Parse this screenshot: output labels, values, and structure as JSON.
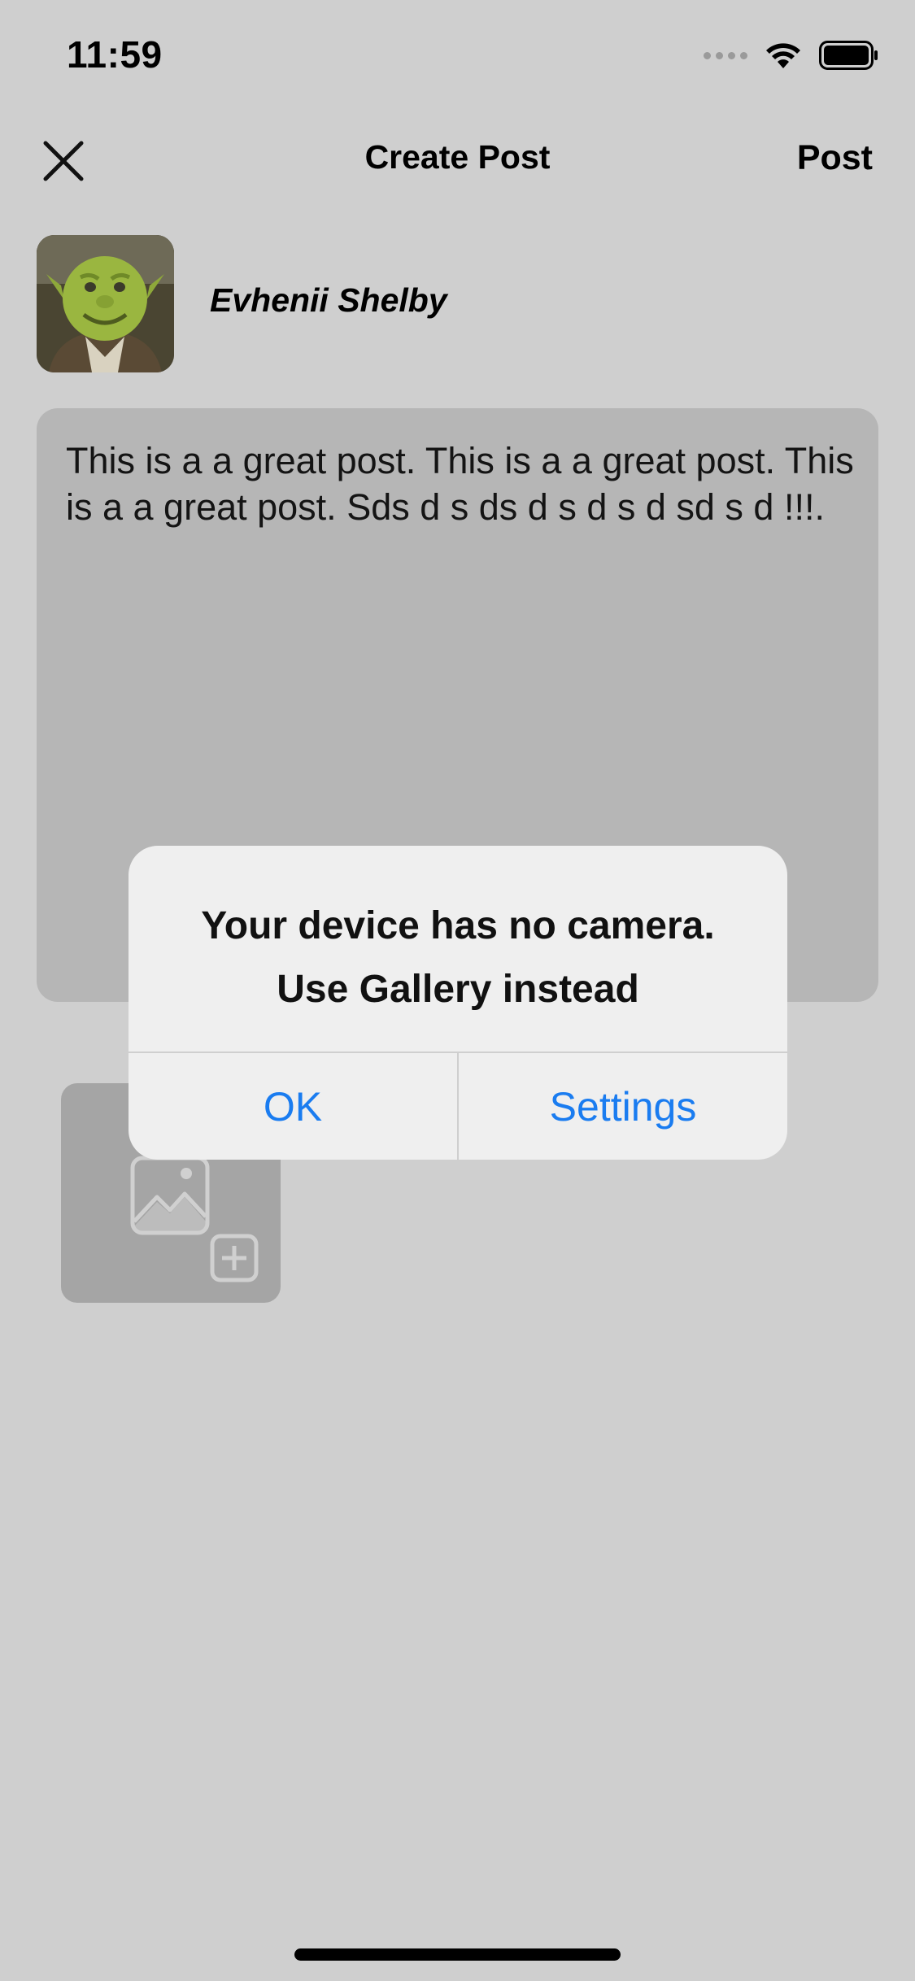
{
  "status_bar": {
    "time": "11:59"
  },
  "nav": {
    "title": "Create Post",
    "post_label": "Post",
    "close_icon": "close-icon"
  },
  "author": {
    "name": "Evhenii Shelby"
  },
  "editor": {
    "text": "This is a a great post. This is a a great post. This is a a great post. Sds d s ds d s d s d sd s d !!!."
  },
  "add_image": {
    "icon": "add-image-icon"
  },
  "alert": {
    "message_line1": "Your device has no camera.",
    "message_line2": "Use Gallery instead",
    "ok_label": "OK",
    "settings_label": "Settings",
    "button_color": "#1a7cf0"
  }
}
